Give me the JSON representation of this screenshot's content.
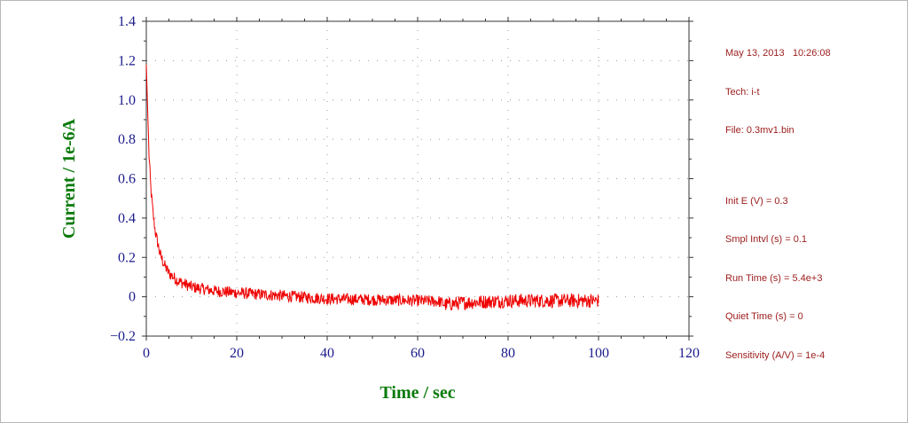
{
  "chart_data": {
    "type": "line",
    "xlabel": "Time / sec",
    "ylabel": "Current / 1e-6A",
    "xlim": [
      0,
      120
    ],
    "ylim": [
      -0.2,
      1.4
    ],
    "xticks": [
      0,
      20,
      40,
      60,
      80,
      100,
      120
    ],
    "yticks": [
      -0.2,
      0,
      0.2,
      0.4,
      0.6,
      0.8,
      1.0,
      1.2,
      1.4
    ],
    "ytick_labels": [
      "−0.2",
      "0",
      "0.2",
      "0.4",
      "0.6",
      "0.8",
      "1.0",
      "1.2",
      "1.4"
    ],
    "grid": "dotted",
    "series": [
      {
        "color": "#ee0000",
        "x": [
          0,
          0.3,
          0.6,
          1,
          1.5,
          2,
          3,
          4,
          5,
          7,
          10,
          15,
          20,
          30,
          40,
          50,
          60,
          65,
          66,
          70,
          80,
          90,
          100
        ],
        "y": [
          1.18,
          0.95,
          0.72,
          0.55,
          0.42,
          0.33,
          0.22,
          0.16,
          0.12,
          0.08,
          0.05,
          0.03,
          0.02,
          0.005,
          -0.01,
          -0.015,
          -0.02,
          -0.025,
          -0.04,
          -0.03,
          -0.02,
          -0.02,
          -0.02
        ],
        "noise": 0.03
      }
    ]
  },
  "info": {
    "date": "May 13, 2013   10:26:08",
    "tech": "Tech: i-t",
    "file": "File: 0.3mv1.bin",
    "params": [
      "Init E (V) = 0.3",
      "Smpl Intvl (s) = 0.1",
      "Run Time (s) = 5.4e+3",
      "Quiet Time (s) = 0",
      "Sensitivity (A/V) = 1e-4"
    ]
  }
}
